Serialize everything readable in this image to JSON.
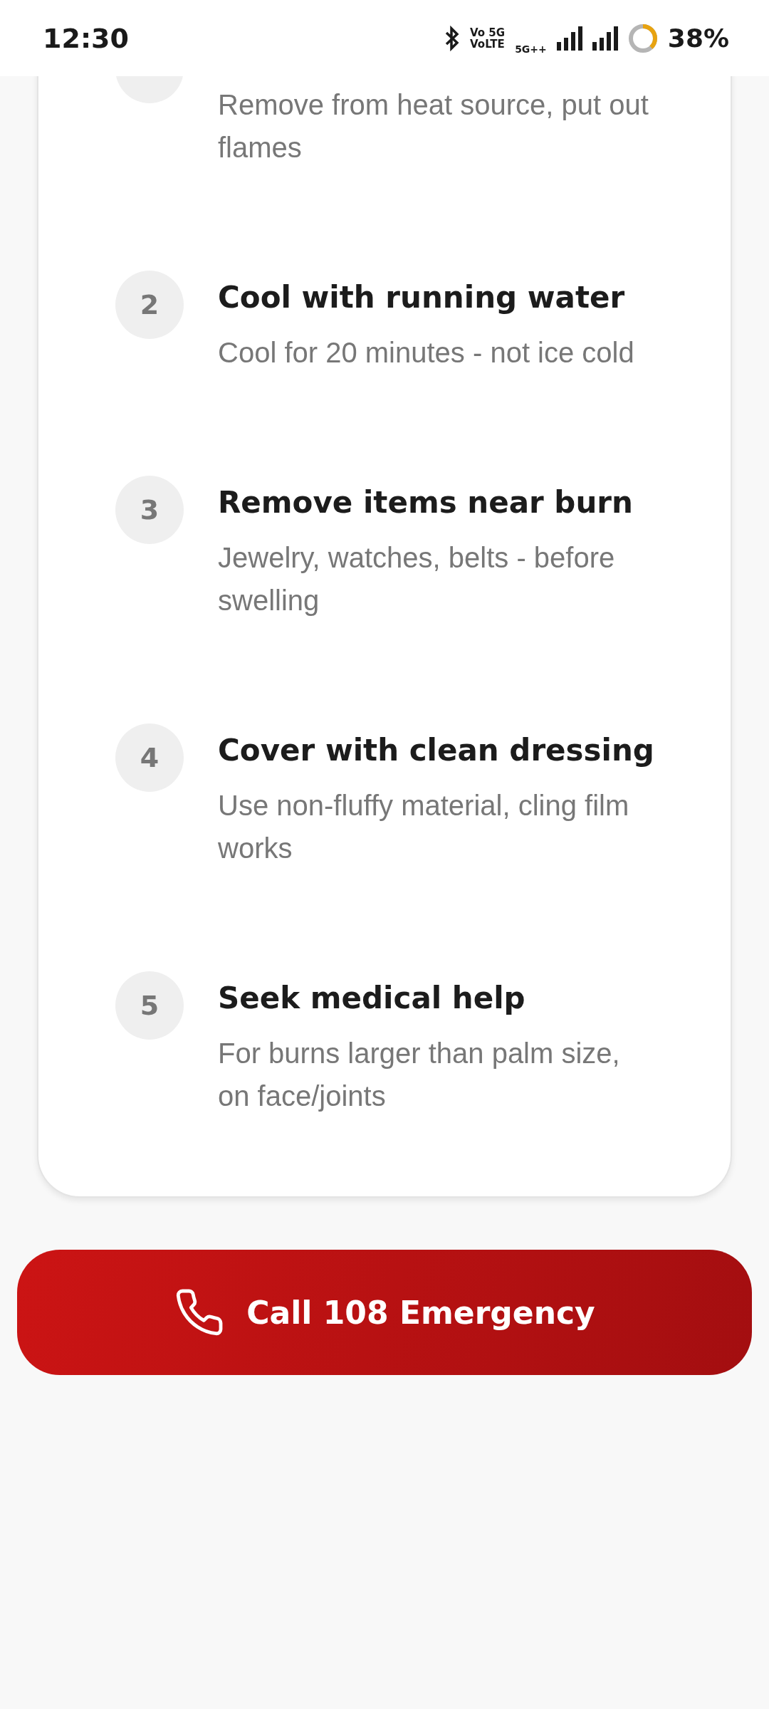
{
  "status_bar": {
    "time": "12:30",
    "sim_labels": [
      "Vo 5G",
      "VoLTE"
    ],
    "network_label": "5G++",
    "battery": {
      "label": "38%"
    }
  },
  "steps": [
    {
      "description": "Remove from heat source, put out flames"
    },
    {
      "number": "2",
      "title": "Cool with running water",
      "description": "Cool for 20 minutes - not ice cold"
    },
    {
      "number": "3",
      "title": "Remove items near burn",
      "description": "Jewelry, watches, belts - before swelling"
    },
    {
      "number": "4",
      "title": "Cover with clean dressing",
      "description": "Use non-fluffy material, cling film works"
    },
    {
      "number": "5",
      "title": "Seek medical help",
      "description": "For burns larger than palm size, on face/joints"
    }
  ],
  "call_button": {
    "label": "Call 108 Emergency"
  }
}
